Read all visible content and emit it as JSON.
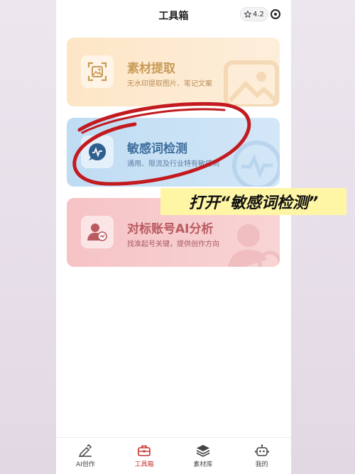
{
  "header": {
    "title": "工具箱",
    "rating": "4.2"
  },
  "cards": [
    {
      "title": "素材提取",
      "subtitle": "无水印提取图片、笔记文案",
      "icon": "image-scan-icon"
    },
    {
      "title": "敏感词检测",
      "subtitle": "通用、限流及行业特有敏感词",
      "icon": "chat-pulse-icon"
    },
    {
      "title": "对标账号AI分析",
      "subtitle": "找准起号关键，提供创作方向",
      "icon": "user-trend-icon"
    }
  ],
  "caption": "打开“敏感词检测”",
  "tabs": [
    {
      "label": "AI创作",
      "icon": "pen-icon"
    },
    {
      "label": "工具箱",
      "icon": "toolbox-icon",
      "active": true
    },
    {
      "label": "素材库",
      "icon": "layers-icon"
    },
    {
      "label": "我的",
      "icon": "robot-icon"
    }
  ],
  "colors": {
    "accent": "#c8302f",
    "scribble": "#c21a1f",
    "caption_bg": "#fff6a5"
  }
}
